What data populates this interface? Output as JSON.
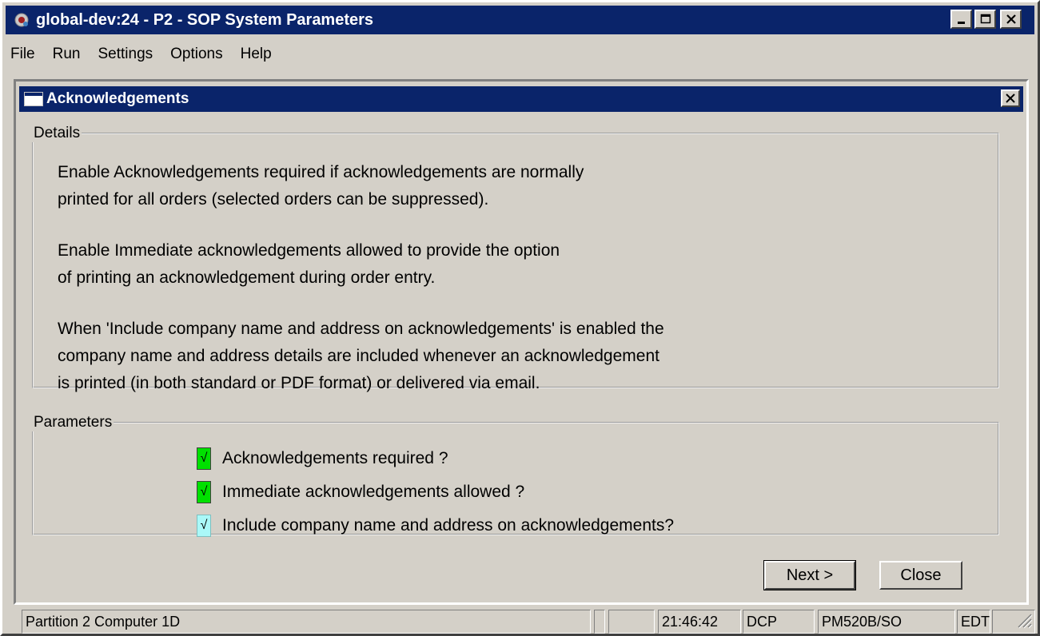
{
  "window": {
    "title": "global-dev:24 - P2 - SOP System Parameters"
  },
  "menu": [
    "File",
    "Run",
    "Settings",
    "Options",
    "Help"
  ],
  "dialog": {
    "title": "Acknowledgements",
    "details": {
      "legend": "Details",
      "lines": [
        "Enable Acknowledgements required if acknowledgements are normally",
        "printed for all orders (selected orders can be suppressed).",
        "Enable Immediate acknowledgements allowed to provide the option",
        "of printing an acknowledgement during order entry.",
        "When 'Include company name and address on acknowledgements' is enabled the",
        "company name and address details are included whenever an acknowledgement",
        "is printed (in both standard or PDF format) or delivered via email."
      ]
    },
    "parameters": {
      "legend": "Parameters",
      "items": [
        {
          "label": "Acknowledgements required ?",
          "checked": true,
          "color": "#00e000"
        },
        {
          "label": "Immediate acknowledgements allowed ?",
          "checked": true,
          "color": "#00e000"
        },
        {
          "label": "Include company name and address on acknowledgements?",
          "checked": true,
          "color": "#aaf8f8"
        }
      ],
      "check_glyph": "√"
    },
    "buttons": {
      "next": "Next >",
      "close": "Close"
    }
  },
  "statusbar": {
    "partition": "Partition 2 Computer 1D",
    "time": "21:46:42",
    "mode": "DCP",
    "program": "PM520B/SO",
    "edit": "EDT"
  }
}
